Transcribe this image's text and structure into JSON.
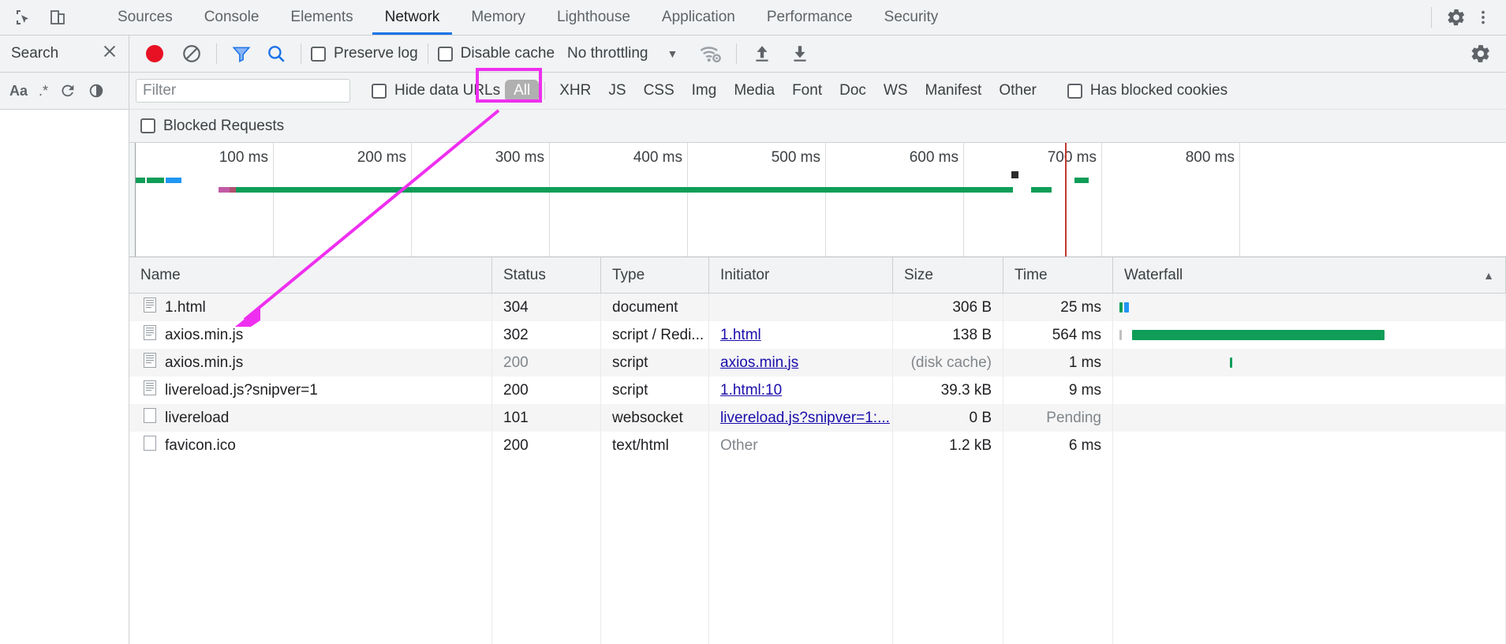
{
  "window": {
    "tabs": [
      {
        "label": "Sources",
        "active": false
      },
      {
        "label": "Console",
        "active": false
      },
      {
        "label": "Elements",
        "active": false
      },
      {
        "label": "Network",
        "active": true
      },
      {
        "label": "Memory",
        "active": false
      },
      {
        "label": "Lighthouse",
        "active": false
      },
      {
        "label": "Application",
        "active": false
      },
      {
        "label": "Performance",
        "active": false
      },
      {
        "label": "Security",
        "active": false
      }
    ],
    "inspect_icon": "inspect-element-icon",
    "device_icon": "device-toolbar-icon",
    "settings_icon": "gear-icon",
    "more_icon": "more-vertical-icon"
  },
  "sidebar": {
    "title": "Search",
    "close_icon": "close-icon",
    "tools": [
      {
        "label": "Aa",
        "name": "match-case-toggle"
      },
      {
        "label": ".*",
        "name": "regex-toggle"
      },
      {
        "label": "↻",
        "name": "refresh-button"
      },
      {
        "label": "◐",
        "name": "clear-button"
      }
    ]
  },
  "toolbar": {
    "record_icon": "record-button",
    "clear_icon": "clear-button",
    "filter_icon": "filter-funnel-icon",
    "search_icon": "search-icon",
    "preserve_log": {
      "label": "Preserve log",
      "checked": false
    },
    "disable_cache": {
      "label": "Disable cache",
      "checked": false
    },
    "throttling": {
      "value": "No throttling",
      "caret": "▼"
    },
    "wifi_icon": "network-conditions-icon",
    "import_icon": "import-har-icon",
    "export_icon": "export-har-icon",
    "settings_icon": "gear-icon"
  },
  "filterbar": {
    "filter_placeholder": "Filter",
    "filter_value": "",
    "hide_data_urls": {
      "label": "Hide data URLs",
      "checked": false
    },
    "types": [
      "All",
      "XHR",
      "JS",
      "CSS",
      "Img",
      "Media",
      "Font",
      "Doc",
      "WS",
      "Manifest",
      "Other"
    ],
    "selected_type": "All",
    "has_blocked_cookies": {
      "label": "Has blocked cookies",
      "checked": false
    },
    "blocked_requests": {
      "label": "Blocked Requests",
      "checked": false
    }
  },
  "overview": {
    "ticks": [
      "100 ms",
      "200 ms",
      "300 ms",
      "400 ms",
      "500 ms",
      "600 ms",
      "700 ms",
      "800 ms"
    ]
  },
  "table": {
    "columns": [
      "Name",
      "Status",
      "Type",
      "Initiator",
      "Size",
      "Time",
      "Waterfall"
    ],
    "sort_indicator": "▲",
    "rows": [
      {
        "name": "1.html",
        "status": "304",
        "type": "document",
        "initiator": "",
        "size": "306 B",
        "time": "25 ms",
        "status_dim": false,
        "size_dim": false,
        "time_dim": false,
        "initiator_link": false,
        "initiator_dim": false
      },
      {
        "name": "axios.min.js",
        "status": "302",
        "type": "script / Redi...",
        "initiator": "1.html",
        "size": "138 B",
        "time": "564 ms",
        "status_dim": false,
        "size_dim": false,
        "time_dim": false,
        "initiator_link": true,
        "initiator_dim": false
      },
      {
        "name": "axios.min.js",
        "status": "200",
        "type": "script",
        "initiator": "axios.min.js",
        "size": "(disk cache)",
        "time": "1 ms",
        "status_dim": true,
        "size_dim": true,
        "time_dim": false,
        "initiator_link": true,
        "initiator_dim": false
      },
      {
        "name": "livereload.js?snipver=1",
        "status": "200",
        "type": "script",
        "initiator": "1.html:10",
        "size": "39.3 kB",
        "time": "9 ms",
        "status_dim": false,
        "size_dim": false,
        "time_dim": false,
        "initiator_link": true,
        "initiator_dim": false
      },
      {
        "name": "livereload",
        "status": "101",
        "type": "websocket",
        "initiator": "livereload.js?snipver=1:...",
        "size": "0 B",
        "time": "Pending",
        "status_dim": false,
        "size_dim": false,
        "time_dim": true,
        "initiator_link": true,
        "initiator_dim": false
      },
      {
        "name": "favicon.ico",
        "status": "200",
        "type": "text/html",
        "initiator": "Other",
        "size": "1.2 kB",
        "time": "6 ms",
        "status_dim": false,
        "size_dim": false,
        "time_dim": false,
        "initiator_link": false,
        "initiator_dim": true
      }
    ]
  },
  "annotation": {
    "color": "#ef2fef",
    "highlight_target": "All",
    "arrow": "pointer-arrow"
  },
  "colors": {
    "accent": "#1a73e8",
    "record_red": "#e81123",
    "link": "#1a0dab",
    "waterfall_green": "#0f9d58",
    "waterfall_blue": "#2196f3",
    "chrome_bg": "#f1f3f4"
  }
}
